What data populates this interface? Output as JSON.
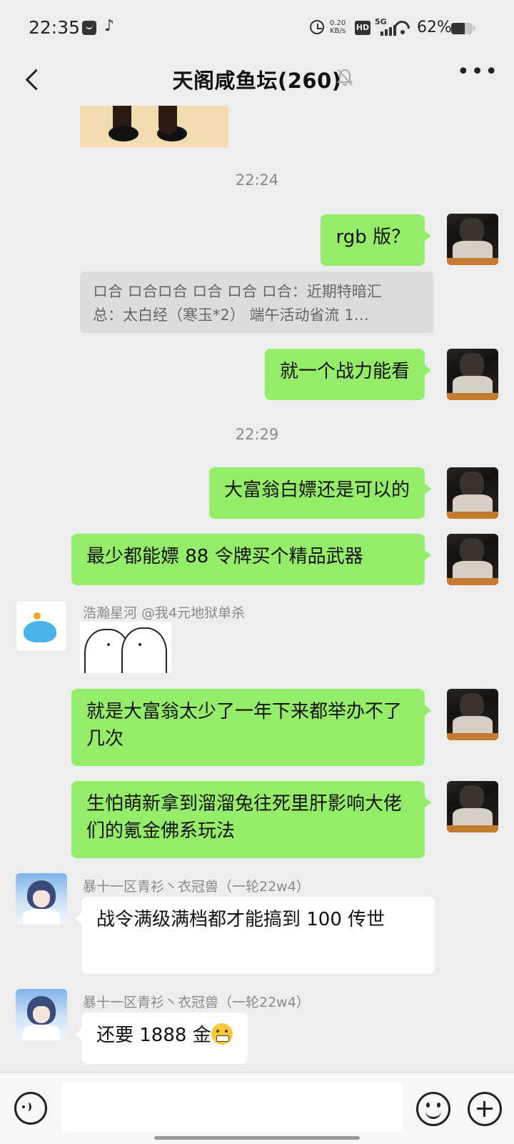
{
  "status_bar": {
    "time": "22:35",
    "speed_value": "0.20",
    "speed_unit": "KB/s",
    "hd": "HD",
    "network": "5G",
    "battery_pct": "62%",
    "battery_level": 0.62
  },
  "header": {
    "title": "天阁咸鱼坛(260)",
    "icons": [
      "back-icon",
      "mute-bell-icon",
      "more-dots-icon"
    ]
  },
  "messages": {
    "ts1": "22:24",
    "m1": "rgb 版？",
    "quote_line1": "ロ合 ロ合ロ合 ロ合 ロ合 ロ合：近期特暗汇",
    "quote_line2": "总：太白经（寒玉*2） 端午活动省流 1…",
    "m2": "就一个战力能看",
    "ts2": "22:29",
    "m3": "大富翁白嫖还是可以的",
    "m4": "最少都能嫖 88 令牌买个精品武器",
    "sender1": "浩瀚星河 @我4元地狱单杀",
    "m5": "就是大富翁太少了一年下来都举办不了几次",
    "m6": "生怕萌新拿到溜溜兔往死里肝影响大佬们的氪金佛系玩法",
    "sender2": "暴十一区青衫丶衣冠兽（一轮22w4）",
    "m7": "战令满级满档都才能搞到 100 传世",
    "sender3": "暴十一区青衫丶衣冠兽（一轮22w4）",
    "m8": "还要 1888 金"
  },
  "input_bar": {
    "placeholder": "",
    "icons": [
      "voice-icon",
      "emoji-icon",
      "plus-icon"
    ]
  },
  "colors": {
    "background": "#ededed",
    "bubble_self": "#95ec69",
    "bubble_other": "#ffffff",
    "quote_bg": "#dcdcdc"
  }
}
